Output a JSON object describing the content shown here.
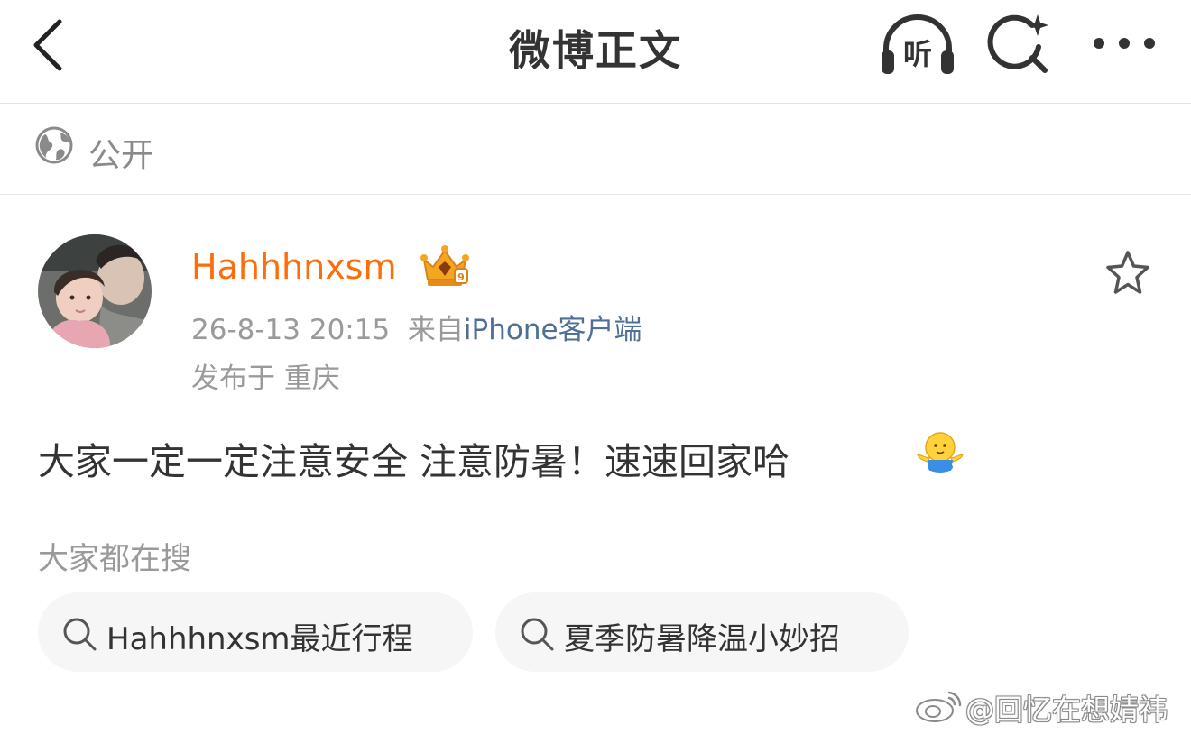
{
  "navbar": {
    "title": "微博正文",
    "listen_label": "听",
    "back_icon": "chevron-left-icon",
    "search_icon": "sparkle-search-icon",
    "more_icon": "more-dots-icon"
  },
  "visibility": {
    "icon": "globe-icon",
    "label": "公开"
  },
  "post": {
    "author": "Hahhhnxsm",
    "badge_icon": "vip-crown-badge-icon",
    "date_time": "26-8-13 20:15",
    "source_prefix": "来自",
    "source_client": "iPhone客户端",
    "location": "发布于 重庆",
    "text": "大家一定一定注意安全 注意防暑！速速回家哈",
    "emoji_icon": "hug-emoji-icon",
    "favorite_icon": "star-outline-icon"
  },
  "search_suggestions": {
    "heading": "大家都在搜",
    "items": [
      {
        "label": "Hahhhnxsm最近行程"
      },
      {
        "label": "夏季防暑降温小妙招"
      }
    ]
  },
  "watermark": {
    "text": "@回忆在想婧祎"
  },
  "colors": {
    "username": "#ff6d0a",
    "source_link": "#4f6f94",
    "muted_text": "#9a9a9a",
    "primary_text": "#333333",
    "chip_bg": "#f6f6f6"
  }
}
